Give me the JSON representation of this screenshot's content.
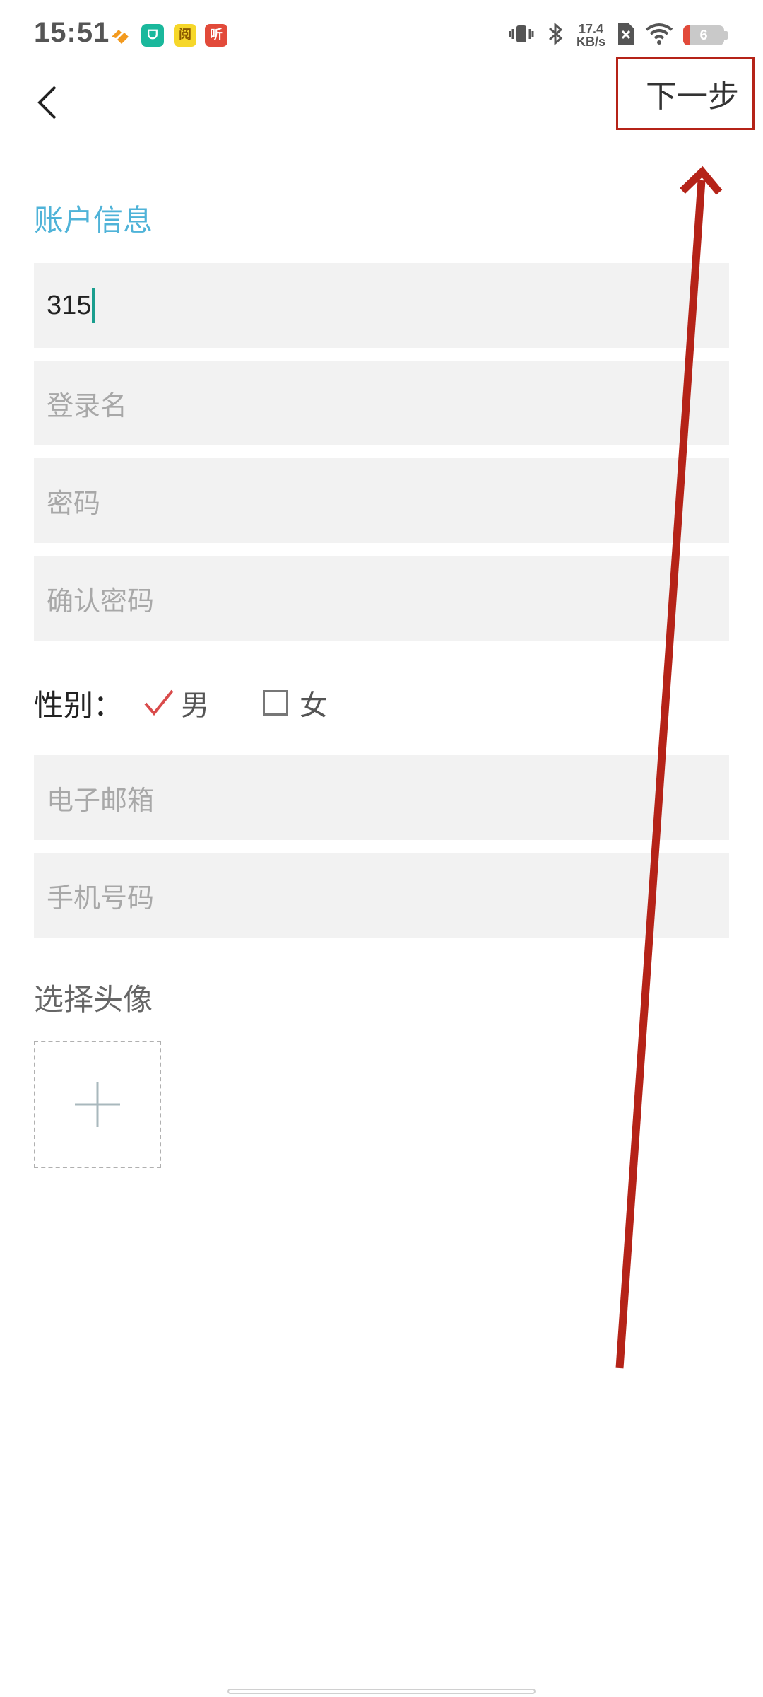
{
  "status_bar": {
    "time": "15:51",
    "app_icons": [
      {
        "name": "health-app-icon",
        "text": ""
      },
      {
        "name": "tmall-app-icon",
        "text": "ᗜ"
      },
      {
        "name": "reader-app-icon",
        "text": "阅"
      },
      {
        "name": "listen-app-icon",
        "text": "听"
      }
    ],
    "net_speed_value": "17.4",
    "net_speed_unit": "KB/s",
    "battery_level": "6"
  },
  "header": {
    "back_icon": "chevron-left-icon",
    "next_label": "下一步"
  },
  "form": {
    "section_title": "账户信息",
    "username_value": "315",
    "login_placeholder": "登录名",
    "password_placeholder": "密码",
    "confirm_password_placeholder": "确认密码",
    "gender_label": "性别：",
    "gender_male": "男",
    "gender_female": "女",
    "gender_selected": "男",
    "email_placeholder": "电子邮箱",
    "phone_placeholder": "手机号码",
    "avatar_label": "选择头像"
  },
  "colors": {
    "accent": "#4fb3d8",
    "annotation": "#b52318",
    "caret": "#1a9e8e",
    "field_bg": "#f2f2f2"
  }
}
